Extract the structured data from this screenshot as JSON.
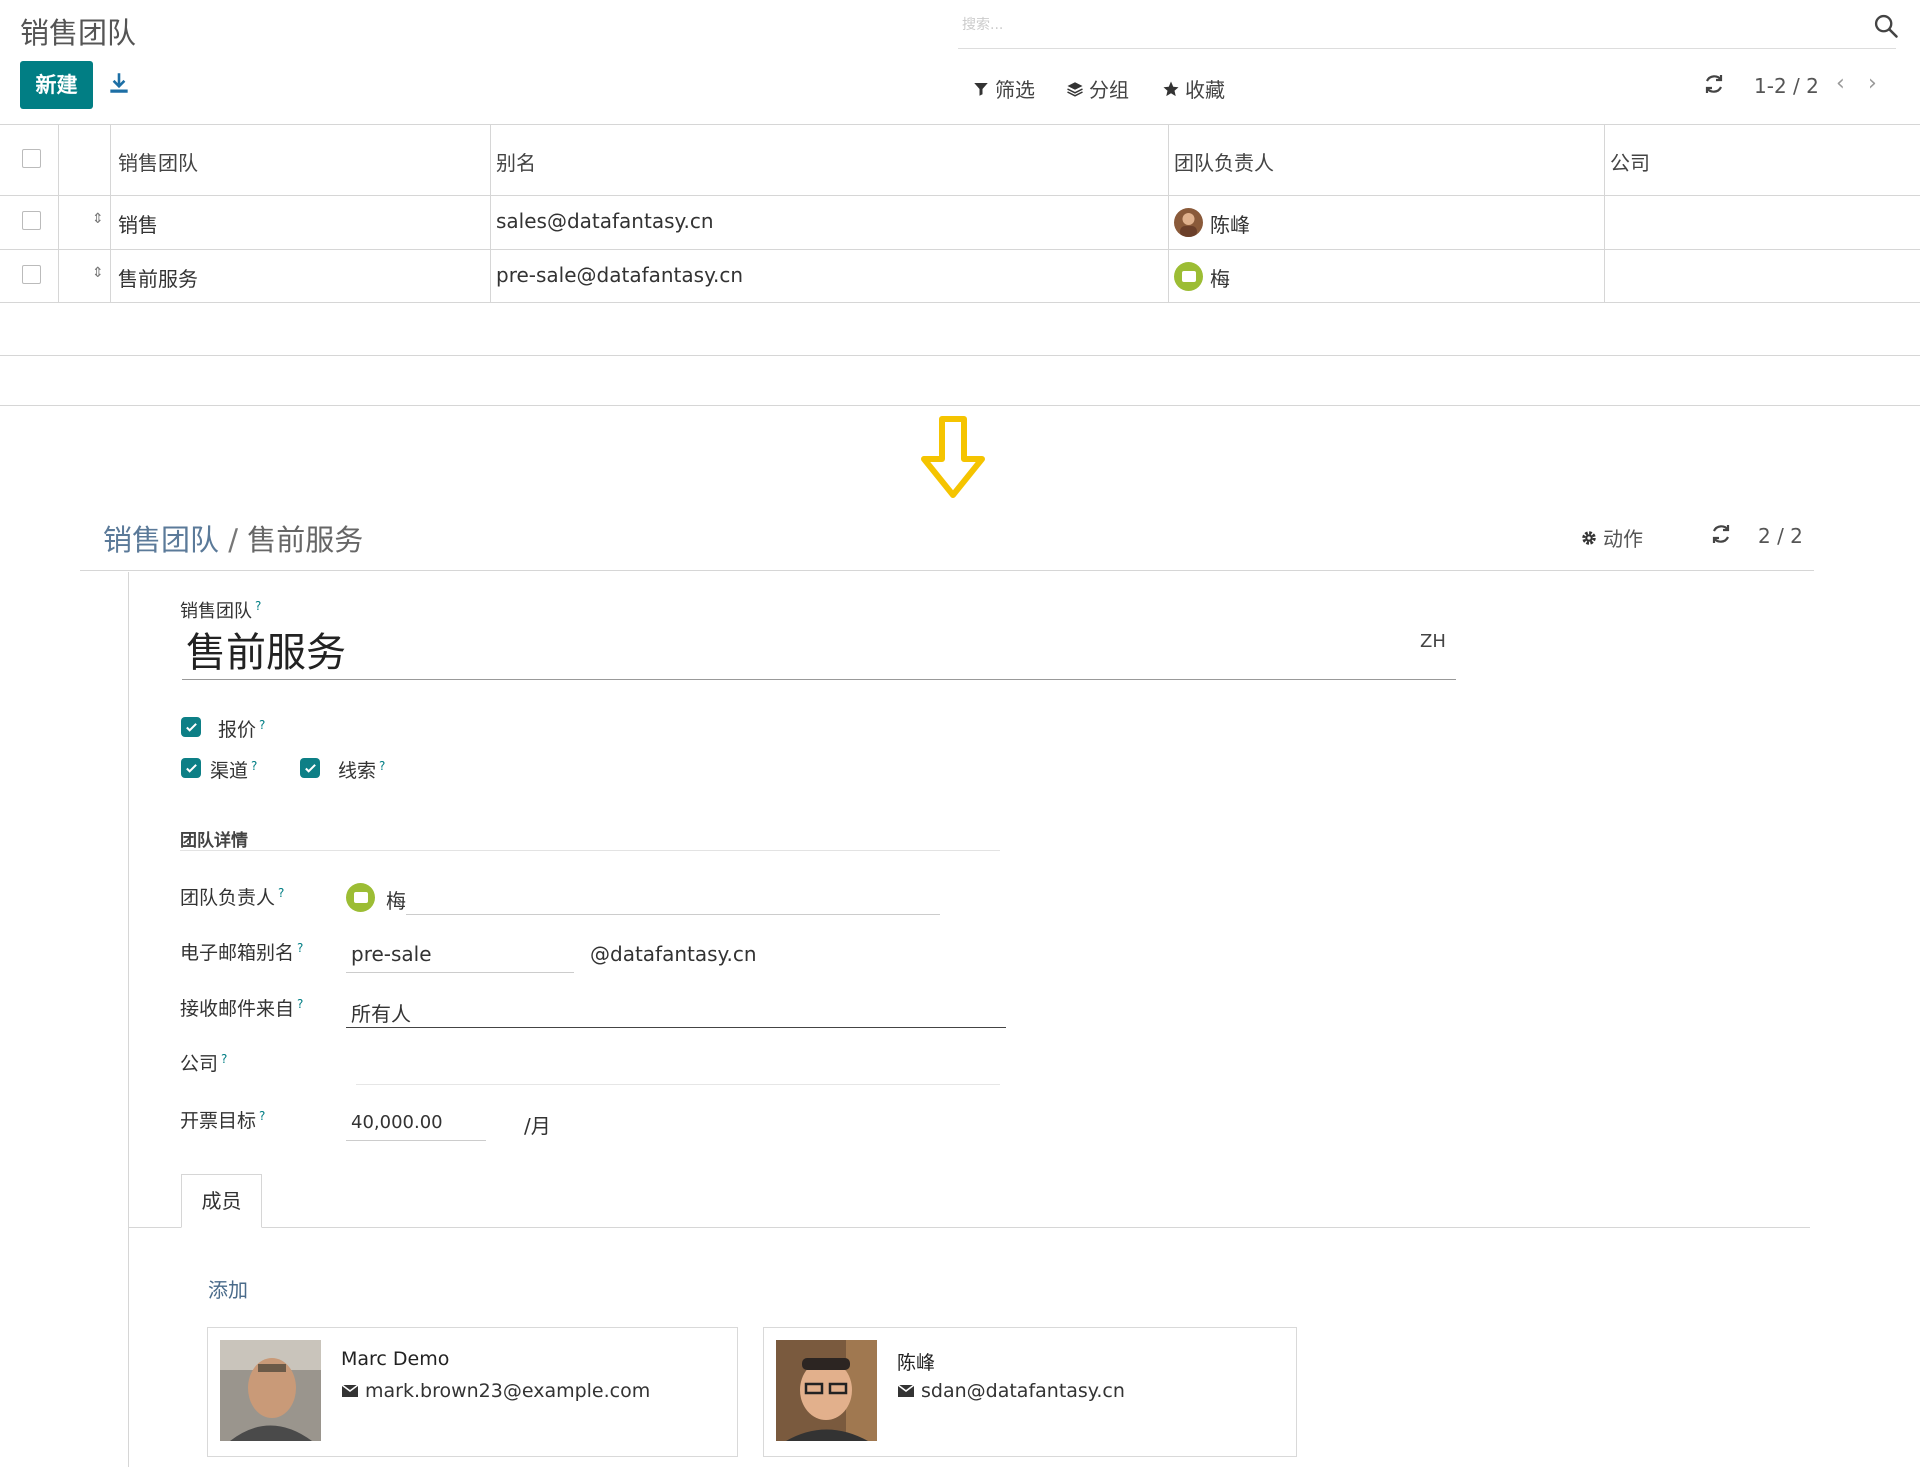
{
  "list_view": {
    "title": "销售团队",
    "search_placeholder": "搜索...",
    "new_button": "新建",
    "toolbar": {
      "filter": "筛选",
      "group": "分组",
      "favorites": "收藏"
    },
    "pager": "1-2 / 2",
    "columns": [
      "销售团队",
      "别名",
      "团队负责人",
      "公司"
    ],
    "rows": [
      {
        "team": "销售",
        "alias": "sales@datafantasy.cn",
        "leader": "陈峰",
        "company": ""
      },
      {
        "team": "售前服务",
        "alias": "pre-sale@datafantasy.cn",
        "leader": "梅",
        "company": ""
      }
    ]
  },
  "arrow_color": "#f5c400",
  "form_view": {
    "breadcrumb_parent": "销售团队",
    "breadcrumb_sep": "/",
    "breadcrumb_current": "售前服务",
    "action_button": "动作",
    "pager": "2 / 2",
    "name_label": "销售团队",
    "name_value": "售前服务",
    "lang": "ZH",
    "checkboxes": {
      "quotations": "报价",
      "pipeline": "渠道",
      "leads": "线索"
    },
    "section_title": "团队详情",
    "fields": {
      "leader_label": "团队负责人",
      "leader_value": "梅",
      "alias_label": "电子邮箱别名",
      "alias_value": "pre-sale",
      "alias_domain": "@datafantasy.cn",
      "accept_label": "接收邮件来自",
      "accept_value": "所有人",
      "company_label": "公司",
      "company_value": "",
      "target_label": "开票目标",
      "target_value": "40,000.00",
      "target_unit": "/月"
    },
    "tab_members": "成员",
    "add_link": "添加",
    "members": [
      {
        "name": "Marc Demo",
        "email": "mark.brown23@example.com"
      },
      {
        "name": "陈峰",
        "email": "sdan@datafantasy.cn"
      }
    ]
  },
  "colors": {
    "primary": "#017e84",
    "checkbox": "#0d7f86",
    "avatar_green": "#9cbd34"
  }
}
